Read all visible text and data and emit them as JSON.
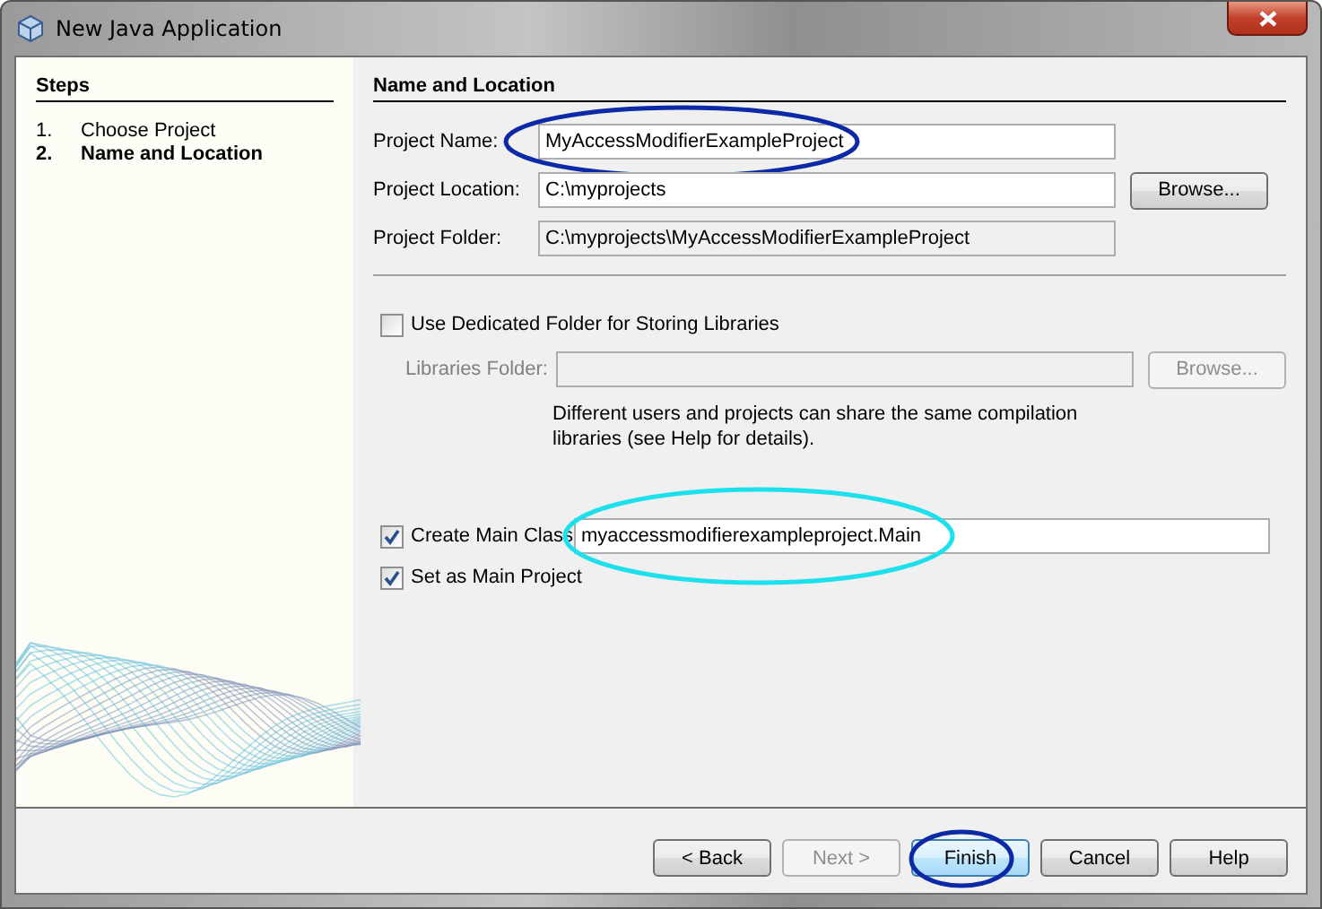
{
  "window": {
    "title": "New Java Application"
  },
  "steps": {
    "title": "Steps",
    "items": [
      {
        "number": "1.",
        "label": "Choose Project",
        "selected": false
      },
      {
        "number": "2.",
        "label": "Name and Location",
        "selected": true
      }
    ]
  },
  "panel": {
    "title": "Name and Location",
    "fields": [
      {
        "label": "Project Name:",
        "value": "MyAccessModifierExampleProject",
        "editable": true
      },
      {
        "label": "Project Location:",
        "value": "C:\\myprojects",
        "editable": true,
        "button": "Browse..."
      },
      {
        "label": "Project Folder:",
        "value": "C:\\myprojects\\MyAccessModifierExampleProject",
        "editable": false
      }
    ],
    "libraries": {
      "checkbox": {
        "label": "Use Dedicated Folder for Storing Libraries",
        "checked": false
      },
      "folder": {
        "label": "Libraries Folder:",
        "disabled": true,
        "button": "Browse..."
      },
      "note": "Different users and projects can share the same compilation libraries (see Help for details)."
    },
    "main_class": {
      "label": "Create Main Class",
      "checked": true,
      "value": "myaccessmodifierexampleproject.Main"
    },
    "main_project": {
      "label": "Set as Main Project",
      "checked": true
    }
  },
  "buttons": [
    {
      "label": "< Back",
      "disabled": false,
      "default": false
    },
    {
      "label": "Next >",
      "disabled": true,
      "default": false
    },
    {
      "label": "Finish",
      "disabled": false,
      "default": true
    },
    {
      "label": "Cancel",
      "disabled": false,
      "default": false
    },
    {
      "label": "Help",
      "disabled": false,
      "default": false
    }
  ],
  "annotations": [
    {
      "kind": "project_name",
      "color": "#0c2aa6"
    },
    {
      "kind": "main_class",
      "color": "#1ee0ec"
    },
    {
      "kind": "finish",
      "color": "#0c2aa6"
    }
  ]
}
